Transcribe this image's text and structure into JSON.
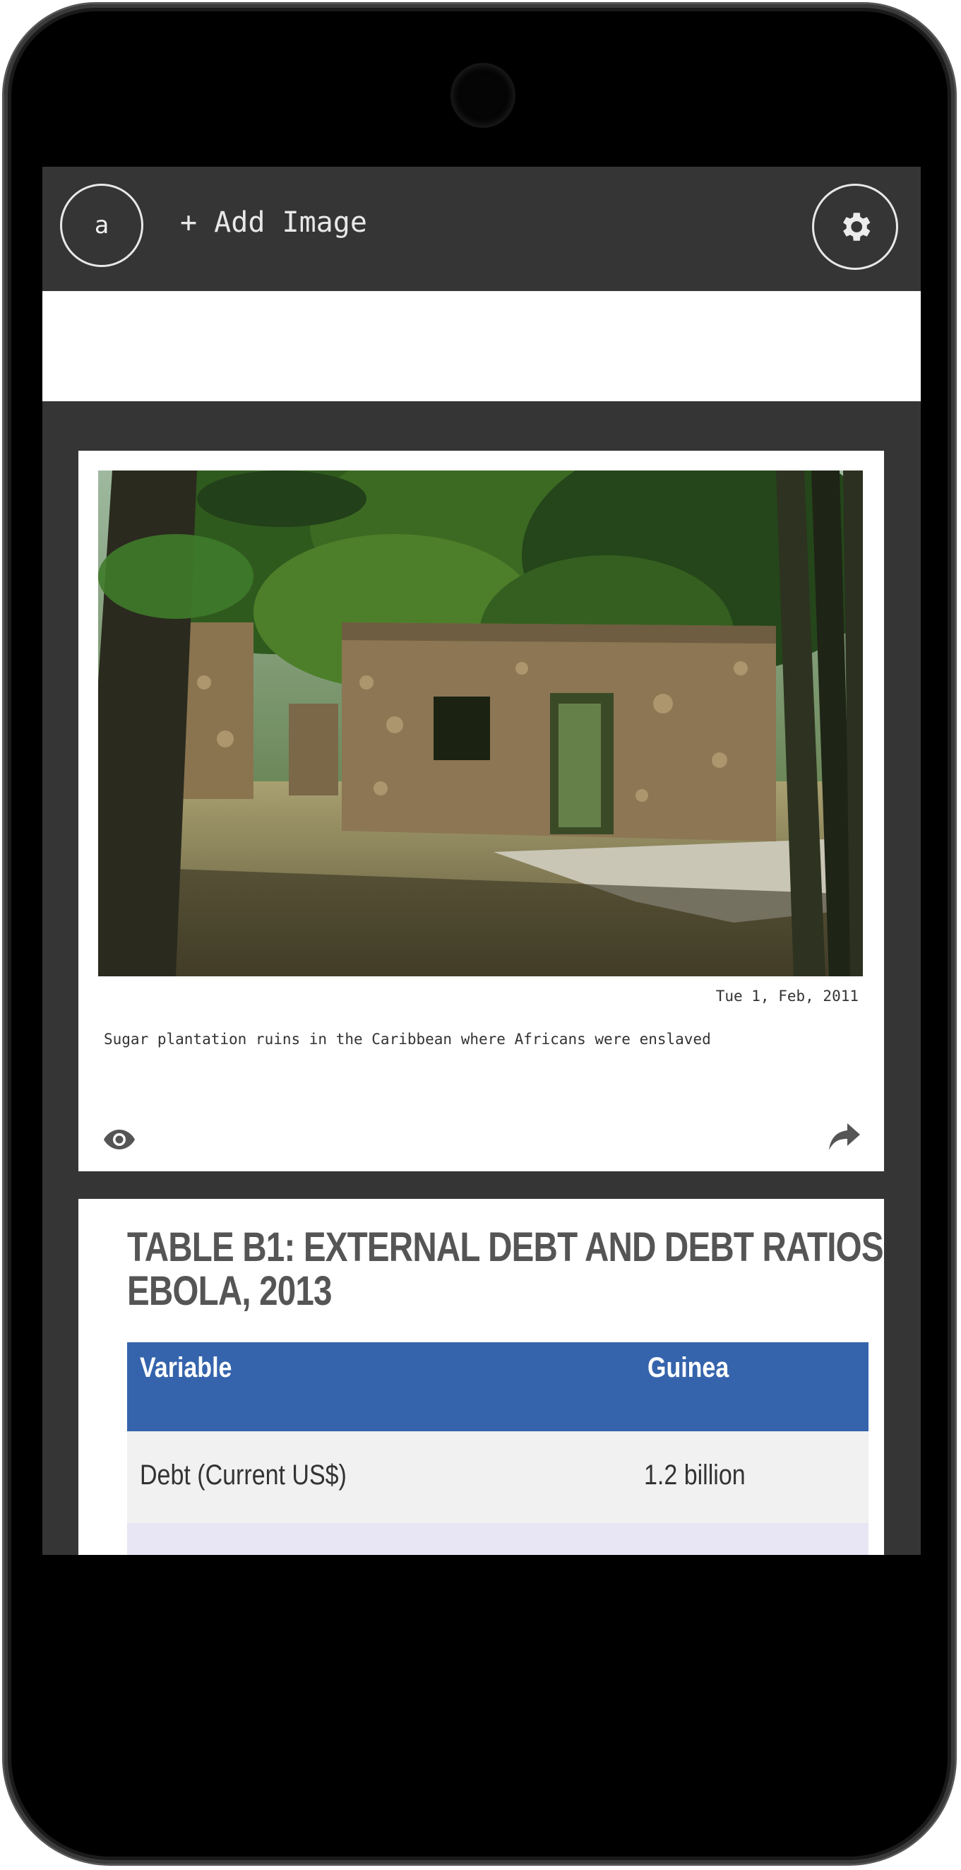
{
  "header": {
    "avatar_letter": "a",
    "add_image_label": "+ Add Image",
    "settings_icon": "gear-icon"
  },
  "feed": [
    {
      "image": "photo of stone plantation ruins among trees",
      "date": "Tue 1, Feb, 2011",
      "caption": "Sugar plantation ruins in the Caribbean where Africans were enslaved",
      "view_icon": "eye-icon",
      "share_icon": "share-icon"
    },
    {
      "table_title_line1": "TABLE B1: EXTERNAL DEBT AND DEBT RATIOS",
      "table_title_line2": "EBOLA, 2013",
      "columns": [
        "Variable",
        "Guinea"
      ],
      "rows": [
        [
          "Debt (Current US$)",
          "1.2 billion"
        ]
      ]
    }
  ],
  "colors": {
    "bar": "#353535",
    "table_header": "#3564ac"
  }
}
